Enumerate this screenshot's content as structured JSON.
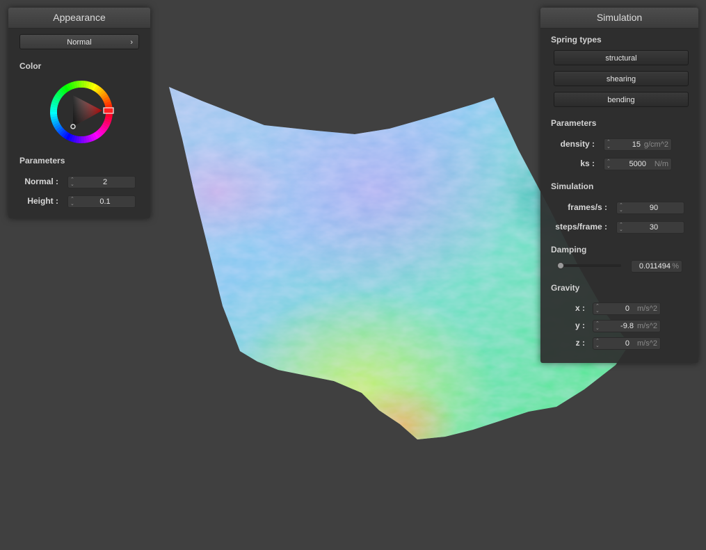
{
  "appearance": {
    "title": "Appearance",
    "shader_select": "Normal",
    "color_label": "Color",
    "params_label": "Parameters",
    "normal": {
      "label": "Normal :",
      "value": "2"
    },
    "height": {
      "label": "Height :",
      "value": "0.1"
    }
  },
  "simulation": {
    "title": "Simulation",
    "spring_types_label": "Spring types",
    "springs": [
      "structural",
      "shearing",
      "bending"
    ],
    "params_label": "Parameters",
    "density": {
      "label": "density :",
      "value": "15",
      "unit": "g/cm^2"
    },
    "ks": {
      "label": "ks :",
      "value": "5000",
      "unit": "N/m"
    },
    "sim_label": "Simulation",
    "fps": {
      "label": "frames/s :",
      "value": "90"
    },
    "steps": {
      "label": "steps/frame :",
      "value": "30"
    },
    "damping_label": "Damping",
    "damping": {
      "value": "0.011494",
      "unit": "%",
      "fraction": 0.01
    },
    "gravity_label": "Gravity",
    "gravity": [
      {
        "label": "x :",
        "value": "0",
        "unit": "m/s^2"
      },
      {
        "label": "y :",
        "value": "-9.8",
        "unit": "m/s^2"
      },
      {
        "label": "z :",
        "value": "0",
        "unit": "m/s^2"
      }
    ]
  },
  "colors": {
    "background": "#404040",
    "panel": "#2d2d2d",
    "picker_hue": "#ff0000"
  },
  "icons": {
    "select_arrow": "chevron-right-icon",
    "spinner": "spinner-arrows-icon"
  }
}
